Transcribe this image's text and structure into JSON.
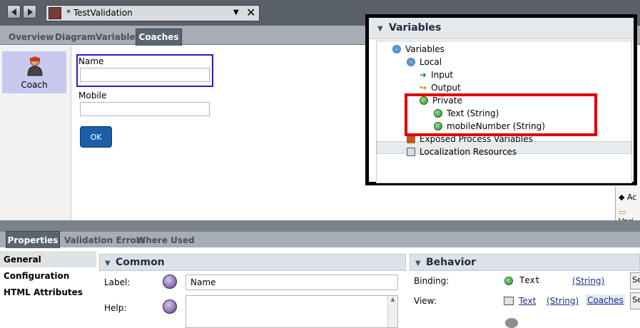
{
  "editor": {
    "title": "* TestValidation"
  },
  "editor_tabs": [
    "Overview",
    "Diagram",
    "Variables",
    "Coaches"
  ],
  "palette": {
    "coach_label": "Coach"
  },
  "canvas": {
    "name_label": "Name",
    "mobile_label": "Mobile",
    "name_value": "",
    "mobile_value": "",
    "ok_button": "OK"
  },
  "variables_panel": {
    "title": "Variables",
    "tree": {
      "root": "Variables",
      "local": "Local",
      "input": "Input",
      "output": "Output",
      "private": "Private",
      "text_var": "Text (String)",
      "mobile_var": "mobileNumber (String)",
      "exposed": "Exposed Process Variables",
      "localization": "Localization Resources"
    }
  },
  "right_stub": {
    "item1": "Ac",
    "item2": "Vari"
  },
  "property_tabs": [
    "Properties",
    "Validation Errors",
    "Where Used"
  ],
  "property_nav": [
    "General",
    "Configuration",
    "HTML Attributes"
  ],
  "common": {
    "title": "Common",
    "label_caption": "Label:",
    "label_value": "Name",
    "help_caption": "Help:",
    "help_value": ""
  },
  "behavior": {
    "title": "Behavior",
    "binding_caption": "Binding:",
    "binding_var": "Text",
    "binding_type": "(String)",
    "view_caption": "View:",
    "view_name": "Text",
    "view_type": "(String)",
    "view_toolkit": "Coaches",
    "select_button": "Se"
  },
  "colors": {
    "highlight_blue": "#2222bb",
    "highlight_red": "#e00000",
    "ok_button": "#1d5fa6",
    "tab_active": "#5a6570"
  }
}
